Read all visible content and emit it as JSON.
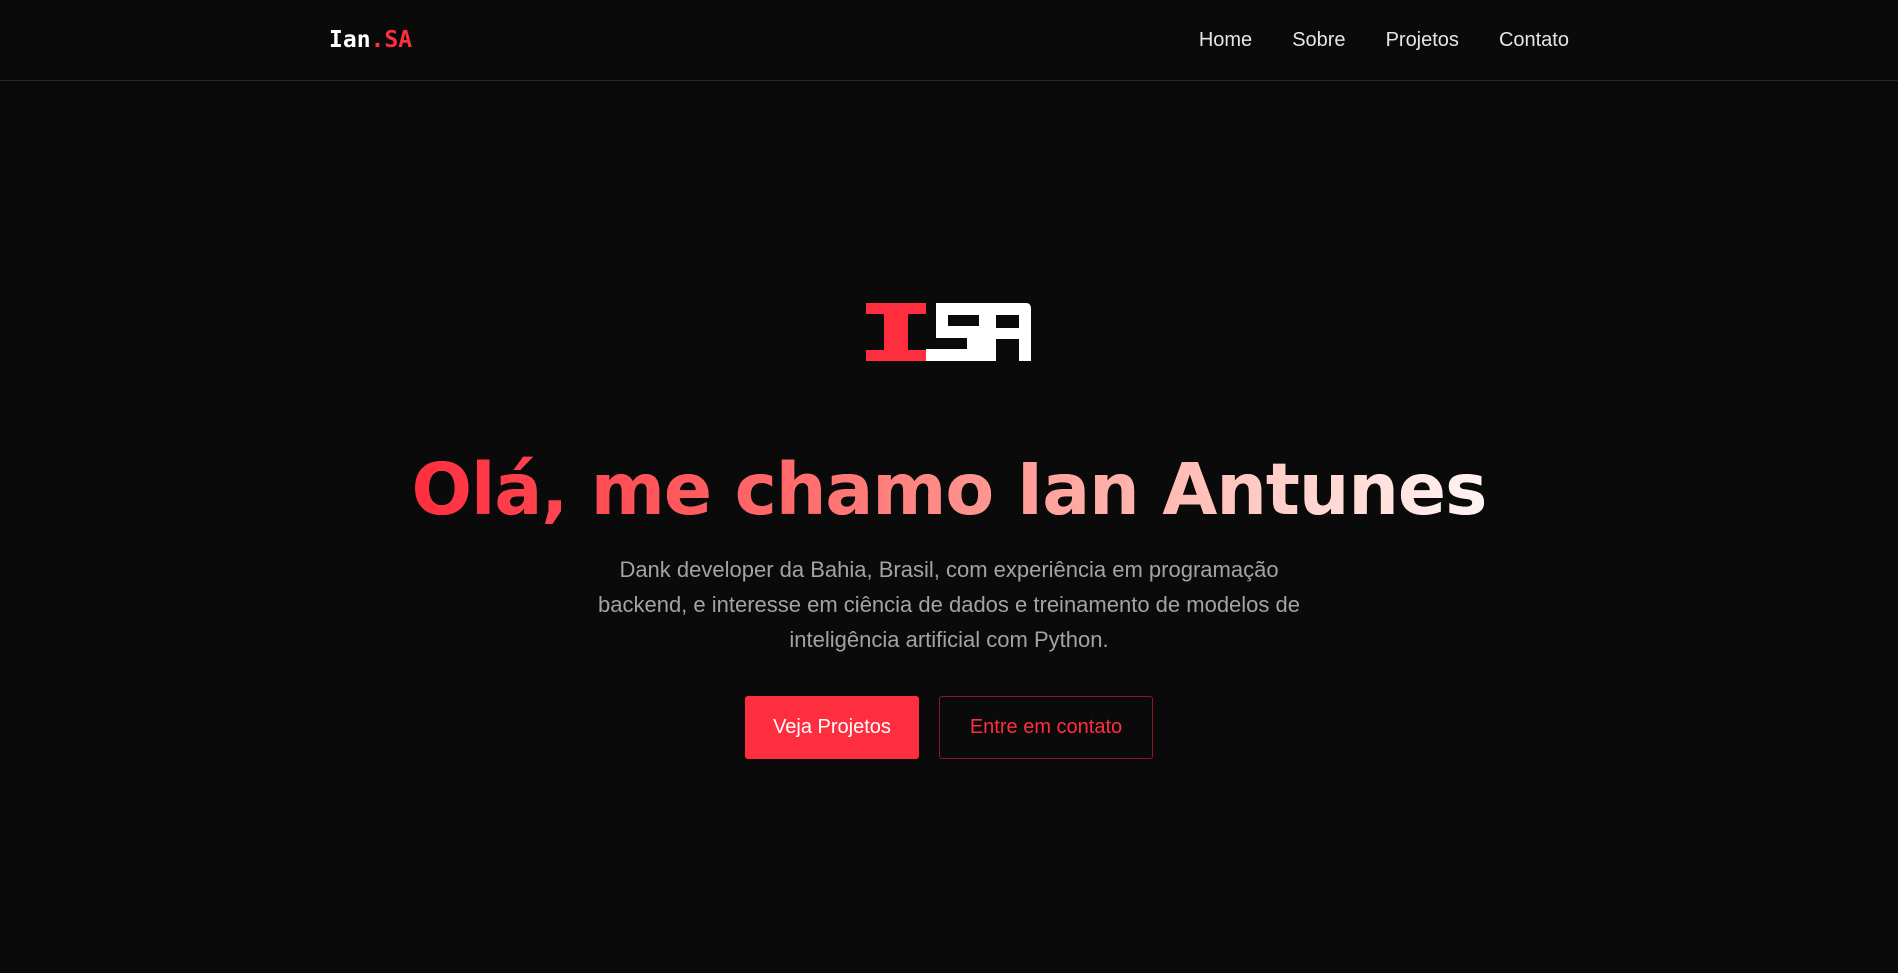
{
  "header": {
    "brand_prefix": "Ian",
    "brand_dot": ".",
    "brand_suffix": "SA",
    "nav": [
      {
        "label": "Home"
      },
      {
        "label": "Sobre"
      },
      {
        "label": "Projetos"
      },
      {
        "label": "Contato"
      }
    ]
  },
  "hero": {
    "logo_text": "ISA",
    "title": "Olá, me chamo Ian Antunes",
    "description": "Dank developer da Bahia, Brasil, com experiência em programação backend, e interesse em ciência de dados e treinamento de modelos de inteligência artificial com Python.",
    "primary_button": "Veja Projetos",
    "secondary_button": "Entre em contato"
  },
  "colors": {
    "background": "#0a0a0a",
    "accent": "#ff2e3f",
    "text_muted": "#a3a3a3",
    "nav_text": "#e5e5e5"
  }
}
